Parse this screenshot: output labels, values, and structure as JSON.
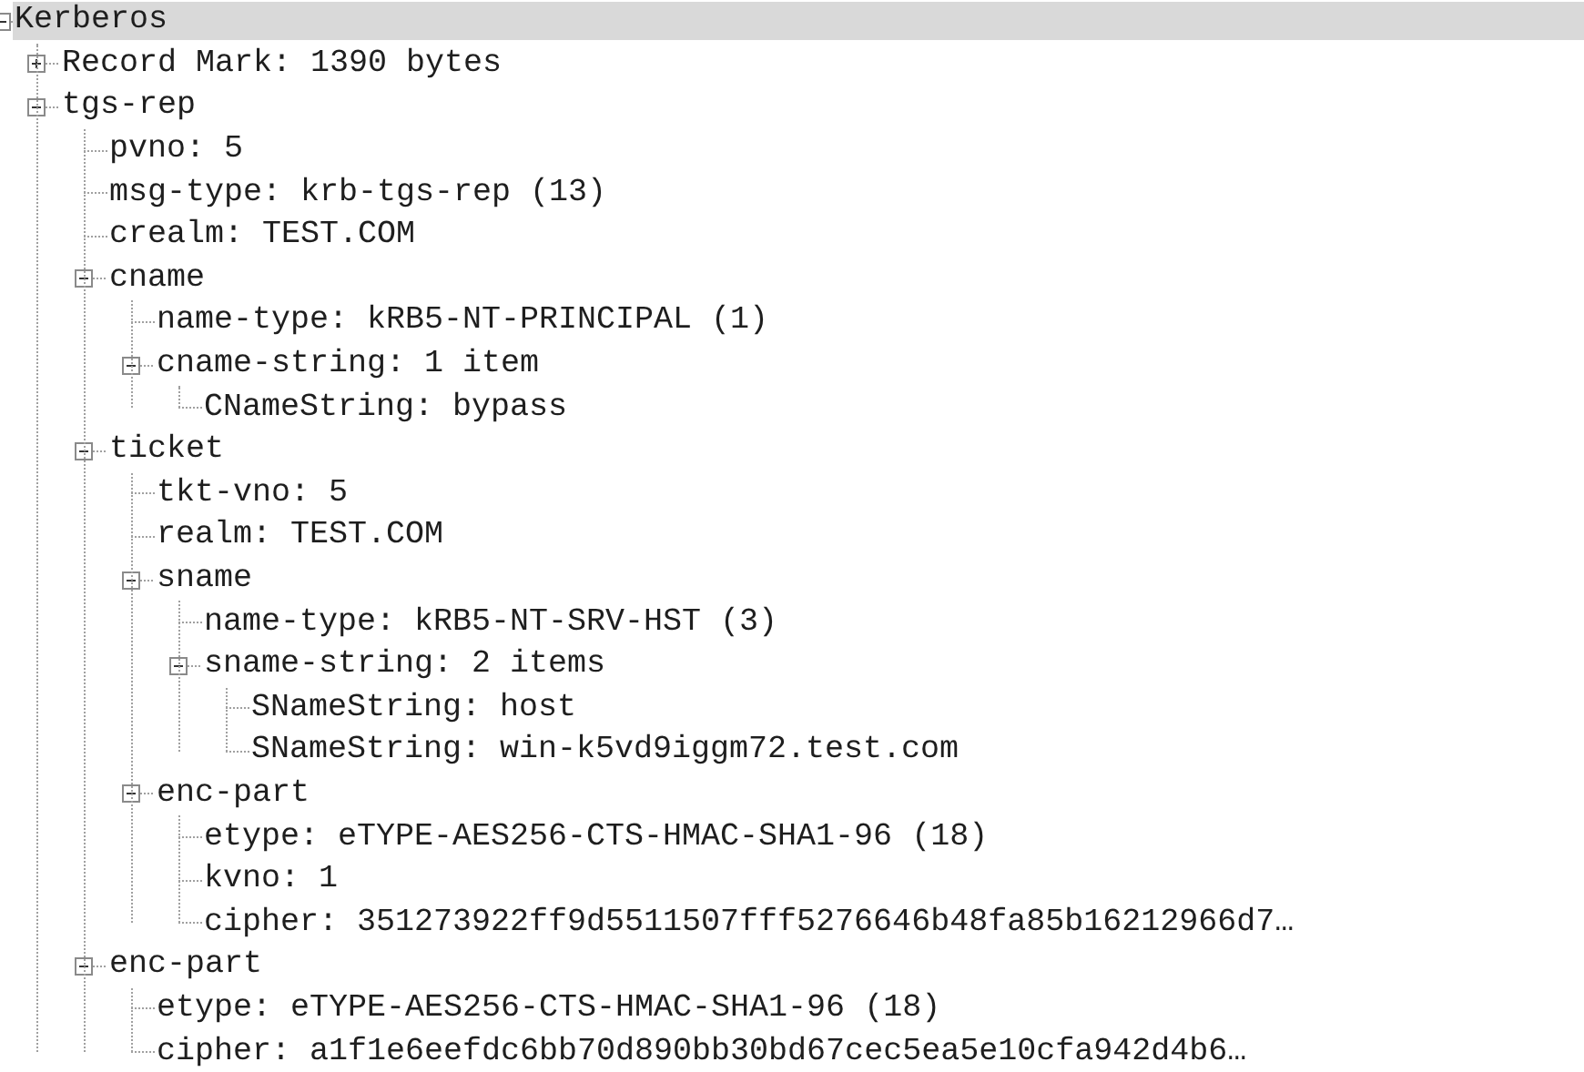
{
  "tree": [
    {
      "label": "Kerberos",
      "selected": true,
      "expanded": true,
      "children": [
        {
          "label": "Record Mark: 1390 bytes",
          "selected": false,
          "expanded": false
        },
        {
          "label": "tgs-rep",
          "selected": false,
          "expanded": true,
          "children": [
            {
              "label": "pvno: 5",
              "selected": false
            },
            {
              "label": "msg-type: krb-tgs-rep (13)",
              "selected": false
            },
            {
              "label": "crealm: TEST.COM",
              "selected": false
            },
            {
              "label": "cname",
              "selected": false,
              "expanded": true,
              "children": [
                {
                  "label": "name-type: kRB5-NT-PRINCIPAL (1)",
                  "selected": false
                },
                {
                  "label": "cname-string: 1 item",
                  "selected": false,
                  "expanded": true,
                  "children": [
                    {
                      "label": "CNameString: bypass",
                      "selected": false
                    }
                  ]
                }
              ]
            },
            {
              "label": "ticket",
              "selected": false,
              "expanded": true,
              "children": [
                {
                  "label": "tkt-vno: 5",
                  "selected": false
                },
                {
                  "label": "realm: TEST.COM",
                  "selected": false
                },
                {
                  "label": "sname",
                  "selected": false,
                  "expanded": true,
                  "children": [
                    {
                      "label": "name-type: kRB5-NT-SRV-HST (3)",
                      "selected": false
                    },
                    {
                      "label": "sname-string: 2 items",
                      "selected": false,
                      "expanded": true,
                      "children": [
                        {
                          "label": "SNameString: host",
                          "selected": false
                        },
                        {
                          "label": "SNameString: win-k5vd9iggm72.test.com",
                          "selected": false
                        }
                      ]
                    }
                  ]
                },
                {
                  "label": "enc-part",
                  "selected": false,
                  "expanded": true,
                  "children": [
                    {
                      "label": "etype: eTYPE-AES256-CTS-HMAC-SHA1-96 (18)",
                      "selected": false
                    },
                    {
                      "label": "kvno: 1",
                      "selected": false
                    },
                    {
                      "label": "cipher: 351273922ff9d5511507fff5276646b48fa85b16212966d7…",
                      "selected": false
                    }
                  ]
                }
              ]
            },
            {
              "label": "enc-part",
              "selected": false,
              "expanded": true,
              "children": [
                {
                  "label": "etype: eTYPE-AES256-CTS-HMAC-SHA1-96 (18)",
                  "selected": false
                },
                {
                  "label": "cipher: a1f1e6eefdc6bb70d890bb30bd67cec5ea5e10cfa942d4b6…",
                  "selected": false
                }
              ]
            }
          ]
        }
      ]
    }
  ]
}
